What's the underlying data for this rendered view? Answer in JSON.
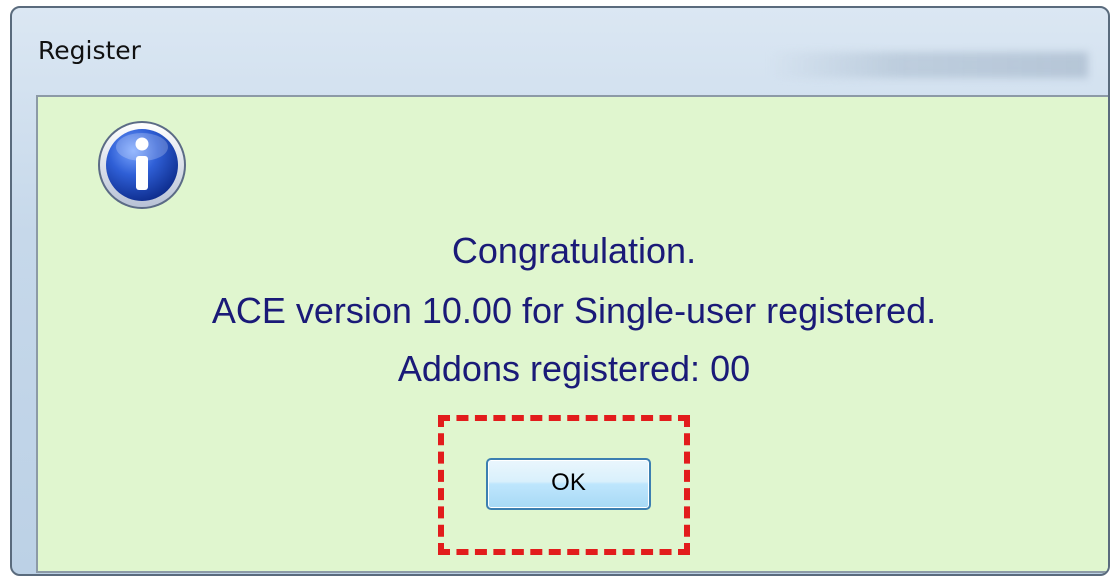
{
  "window": {
    "title": "Register"
  },
  "dialog": {
    "icon": "info-icon",
    "lines": [
      "Congratulation.",
      "ACE version 10.00 for Single-user registered.",
      "Addons registered: 00"
    ],
    "ok_label": "OK"
  },
  "colors": {
    "client_background": "#e0f6cf",
    "message_text": "#1a1a78",
    "highlight_border": "#e21c1c"
  }
}
